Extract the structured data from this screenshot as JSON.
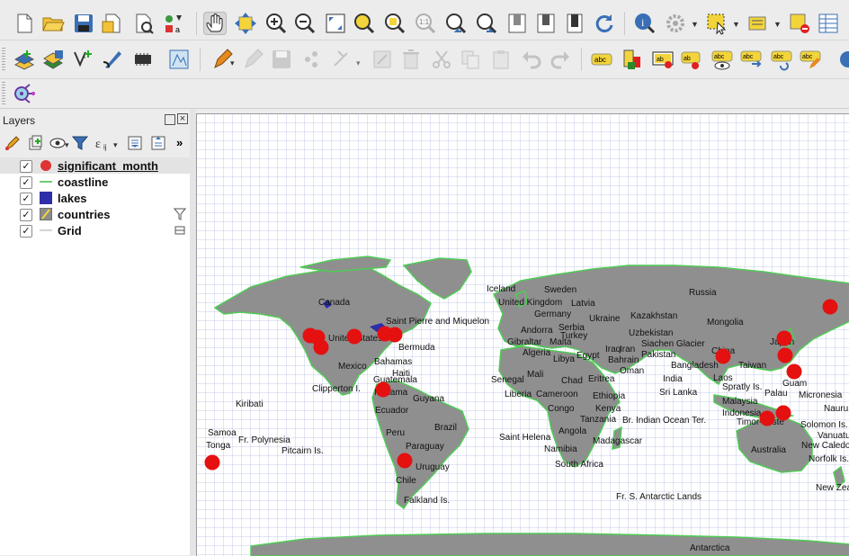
{
  "toolbars": {
    "row1": [
      "new-project-icon",
      "open-project-icon",
      "save-project-icon",
      "save-as-icon",
      "print-layout-icon",
      "style-manager-icon",
      "pan-map-icon",
      "pan-to-selection-icon",
      "zoom-in-icon",
      "zoom-out-icon",
      "zoom-full-icon",
      "zoom-to-selection-icon",
      "zoom-to-layer-icon",
      "zoom-native-icon",
      "zoom-last-icon",
      "zoom-next-icon",
      "new-bookmark-icon",
      "show-bookmarks-icon",
      "refresh-icon",
      "identify-icon",
      "actions-icon",
      "select-features-icon",
      "open-attribute-table-icon",
      "measure-icon",
      "statistics-icon"
    ],
    "row2": [
      "add-vector-layer-icon",
      "add-raster-layer-icon",
      "add-delimited-text-icon",
      "add-wms-icon",
      "add-mesh-icon",
      "digitize-icon",
      "toggle-editing-icon",
      "save-edits-icon",
      "add-feature-icon",
      "vertex-tool-icon",
      "modify-attributes-icon",
      "delete-selected-icon",
      "cut-features-icon",
      "copy-features-icon",
      "paste-features-icon",
      "undo-icon",
      "redo-icon",
      "label-tool-icon",
      "pin-labels-icon",
      "highlight-pinned-icon",
      "show-hide-labels-icon",
      "preview-labels-icon",
      "move-label-icon",
      "rotate-label-icon",
      "change-label-icon"
    ],
    "row3": [
      "gps-plugin-icon"
    ]
  },
  "layers_panel": {
    "title": "Layers",
    "more_tools": "»",
    "layers": [
      {
        "name": "significant_month",
        "checked": true,
        "symbol": "red-circle",
        "selected": true,
        "color": "#dd3333"
      },
      {
        "name": "coastline",
        "checked": true,
        "symbol": "green-line",
        "color": "#44bb44"
      },
      {
        "name": "lakes",
        "checked": true,
        "symbol": "blue-fill",
        "color": "#2e2ea8"
      },
      {
        "name": "countries",
        "checked": true,
        "symbol": "grey-fill",
        "indicator": "filter-icon",
        "color": "#8c8c8c"
      },
      {
        "name": "Grid",
        "checked": true,
        "symbol": "grey-line",
        "indicator": "embedded-icon",
        "color": "#aaaaaa"
      }
    ]
  },
  "map": {
    "grid_color": "#3344aa",
    "land_color": "#8f8f8f",
    "coast_color": "#4fcc55",
    "point_color": "#e51010",
    "labels": [
      "Iceland",
      "Sweden",
      "Latvia",
      "United Kingdom",
      "Russia",
      "Germany",
      "Ukraine",
      "Kazakhstan",
      "Canada",
      "Andorra",
      "Saint Pierre and Miquelon",
      "Uzbekistan",
      "Mongolia",
      "Serbia",
      "Turkey",
      "United States",
      "Gibraltar",
      "Malta",
      "Iraq",
      "Iran",
      "Siachen Glacier",
      "Japan",
      "Bermuda",
      "Algeria",
      "Egypt",
      "Bahrain",
      "Pakistan",
      "China",
      "Libya",
      "Bahamas",
      "Oman",
      "Bangladesh",
      "Taiwan",
      "Mexico",
      "Haiti",
      "Mali",
      "Eritrea",
      "India",
      "Laos",
      "Guatemala",
      "Senegal",
      "Chad",
      "Spratly Is.",
      "Guam",
      "Clipperton I.",
      "Panama",
      "Liberia",
      "Cameroon",
      "Ethiopia",
      "Sri Lanka",
      "Palau",
      "Micronesia",
      "Guyana",
      "Malaysia",
      "Nauru",
      "Kiribati",
      "Ecuador",
      "Congo",
      "Kenya",
      "Indonesia",
      "Tanzania",
      "Br. Indian Ocean Ter.",
      "Timor-Leste",
      "Solomon Is.",
      "Brazil",
      "Peru",
      "Vanuatu",
      "Samoa",
      "Angola",
      "Fr. Polynesia",
      "Saint Helena",
      "Madagascar",
      "Australia",
      "New Caledonia",
      "Tonga",
      "Paraguay",
      "Namibia",
      "Norfolk Is.",
      "Pitcairn Is.",
      "Uruguay",
      "South Africa",
      "Chile",
      "New Zealand",
      "Falkland Is.",
      "Fr. S. Antarctic Lands",
      "Antarctica"
    ]
  }
}
